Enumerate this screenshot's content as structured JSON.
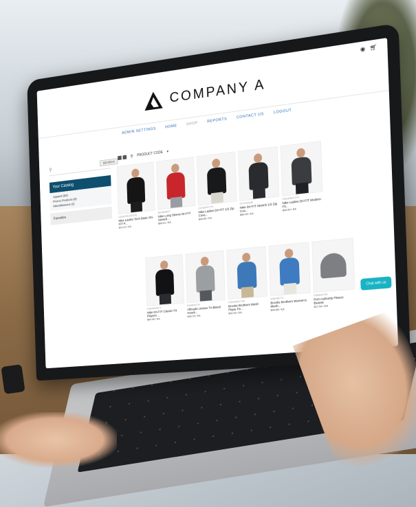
{
  "site": {
    "logo_text": "COMPANY A",
    "nav": [
      {
        "label": "ADMIN SETTINGS",
        "muted": false
      },
      {
        "label": "HOME",
        "muted": false
      },
      {
        "label": "SHOP",
        "muted": true
      },
      {
        "label": "REPORTS",
        "muted": false
      },
      {
        "label": "CONTACT US",
        "muted": false
      },
      {
        "label": "LOGOUT",
        "muted": false
      }
    ],
    "accent": "#0e4e6e",
    "chat_color": "#19b3c4"
  },
  "sidebar": {
    "search_button": "SEARCH",
    "catalog_title": "Your Catalog",
    "catalog_items": [
      "Apparel (93)",
      "Promo Products (8)",
      "Miscellaneous (2)"
    ],
    "favorites": "Favorites"
  },
  "view": {
    "sort_label": "PRODUCT CODE"
  },
  "products": [
    {
      "sku": "CS20N7812N3726",
      "name": "Nike Ladies Tech Basic Dri-FIT P...",
      "price": "$70.14 / EA",
      "shirt": "#151515",
      "pants": "#1d1d1d"
    },
    {
      "sku": "3843845577",
      "name": "Nike Long Sleeve Dri-FIT Stretch...",
      "price": "$66.51 / EA",
      "shirt": "#c8262c",
      "pants": "#9a9ea3"
    },
    {
      "sku": "CS780757779",
      "name": "Nike Ladies Dri-FIT 1/2 Zip Cove...",
      "price": "$46.69 / EA",
      "shirt": "#18191b",
      "pants": "#d9d7d0"
    },
    {
      "sku": "3779753255",
      "name": "Nike Dri-FIT Stretch 1/2 Zip Cov...",
      "price": "$64.05 / EA",
      "shirt": "#2a2b2e",
      "pants": "#2b2c30"
    },
    {
      "sku": "CS6163007279",
      "name": "Nike Ladies Dri-FIT Modern Fit...",
      "price": "$40.50 / EA",
      "shirt": "#3a3c40",
      "pants": "#202124"
    },
    {
      "sku": "CS640025271",
      "name": "Nike Dri-FIT Classic Fit Players ...",
      "price": "$64.45 / EA",
      "shirt": "#121214",
      "pants": "#2b2c30"
    },
    {
      "sku": "2444003779",
      "name": "Allmade Unisex Tri-Blend Hoodi...",
      "price": "$35.76 / EA",
      "shirt": "#9c9fa2",
      "pants": "#55585c"
    },
    {
      "sku": "CS6163007728",
      "name": "Brooks Brothers Mesh Pique Pe...",
      "price": "$42.45 / EA",
      "shirt": "#3d79b8",
      "pants": "#c8b89a"
    },
    {
      "sku": "3180782771",
      "name": "Brooks Brothers Women's Mesh...",
      "price": "$44.68 / EA",
      "shirt": "#3e7bc1",
      "pants": "#e8e6e0"
    },
    {
      "sku": "0781822709",
      "name": "Port Authority Fleece Beanie",
      "price": "$17.54 / EA",
      "beanie": true
    }
  ],
  "chat": {
    "label": "Chat with us"
  },
  "icons": [
    "search-icon",
    "cart-icon",
    "user-icon",
    "grid-view-icon",
    "list-view-icon"
  ]
}
